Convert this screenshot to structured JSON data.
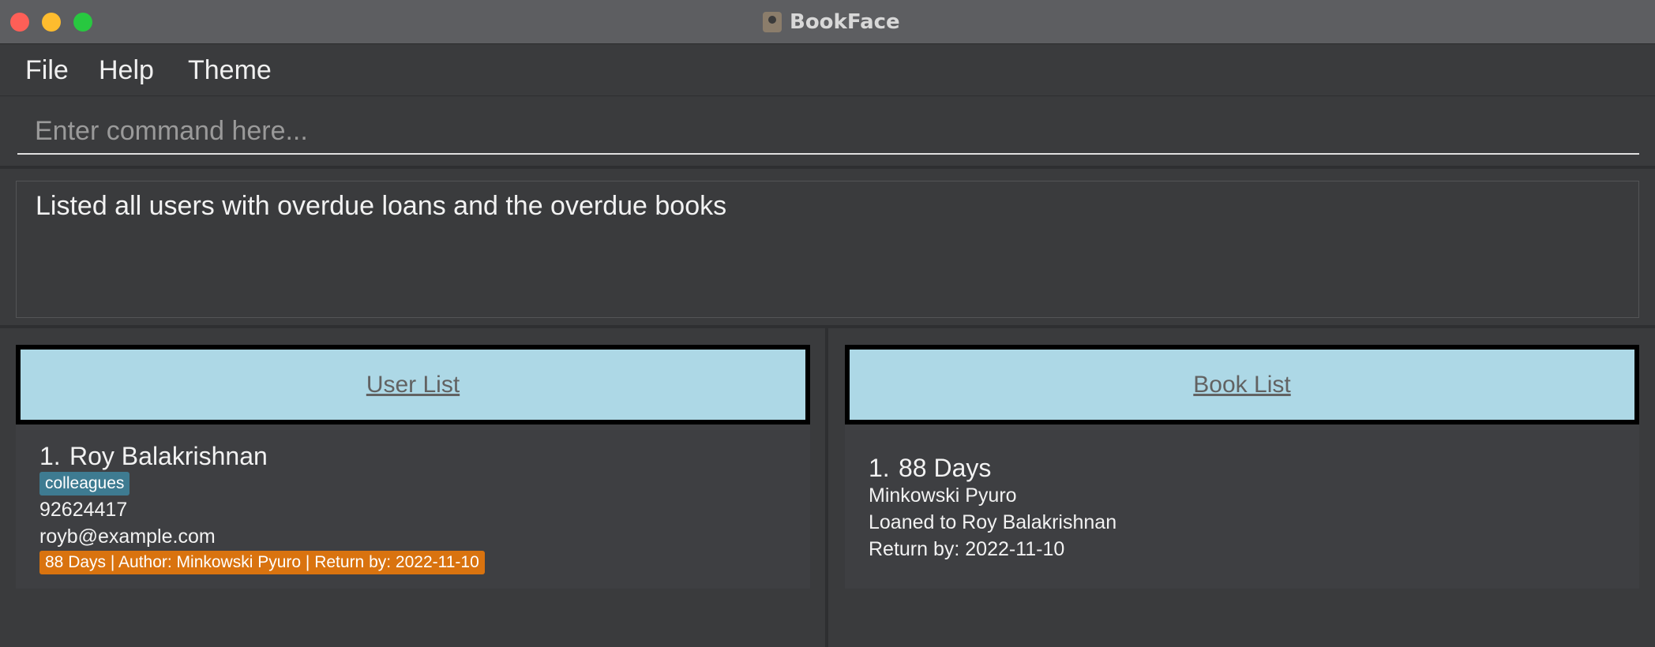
{
  "window": {
    "title": "BookFace"
  },
  "menu": {
    "items": [
      "File",
      "Help",
      "Theme"
    ]
  },
  "command": {
    "placeholder": "Enter command here...",
    "value": ""
  },
  "result": {
    "message": "Listed all users with overdue loans and the overdue books"
  },
  "user_panel": {
    "header": "User List",
    "users": [
      {
        "index": "1.",
        "name": "Roy Balakrishnan",
        "tag": "colleagues",
        "phone": "92624417",
        "email": "royb@example.com",
        "loan": "88 Days | Author: Minkowski Pyuro | Return by: 2022-11-10"
      }
    ]
  },
  "book_panel": {
    "header": "Book List",
    "books": [
      {
        "index": "1.",
        "title": "88 Days",
        "author": "Minkowski Pyuro",
        "loaned_to": "Loaned to Roy Balakrishnan",
        "return_by": "Return by: 2022-11-10"
      }
    ]
  },
  "colors": {
    "window_bg": "#3a3b3d",
    "header_bg": "#add8e6",
    "tag_bg": "#3e7b91",
    "loan_bg": "#d9730f"
  }
}
